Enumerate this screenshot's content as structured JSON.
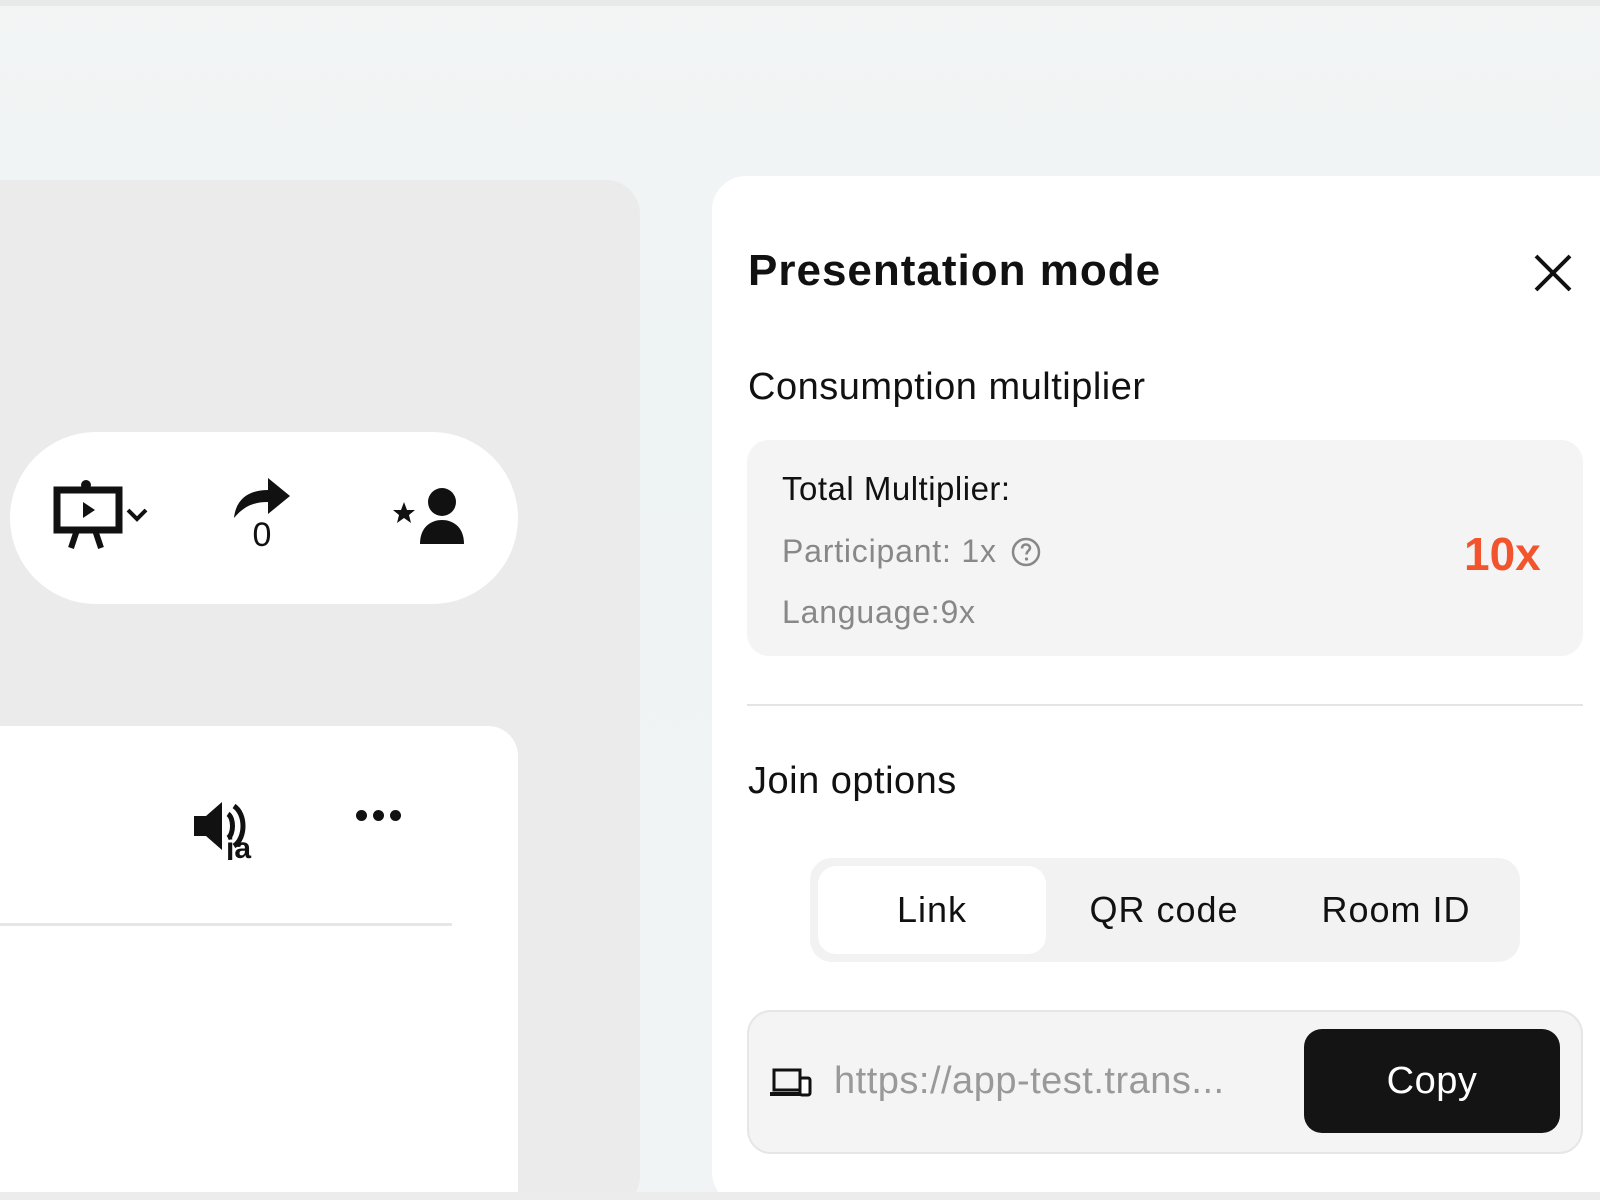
{
  "toolbar": {
    "share_count": "0"
  },
  "audio": {
    "language_badge": "ja"
  },
  "panel": {
    "title": "Presentation mode",
    "consumption_label": "Consumption multiplier",
    "multiplier": {
      "total_label": "Total Multiplier:",
      "participant_label": "Participant: 1x",
      "language_label": "Language:9x",
      "total_value": "10x",
      "value_color": "#f2542d"
    },
    "join_label": "Join options",
    "tabs": [
      {
        "label": "Link",
        "selected": true
      },
      {
        "label": "QR code",
        "selected": false
      },
      {
        "label": "Room ID",
        "selected": false
      }
    ],
    "link": {
      "url": "https://app-test.trans...",
      "copy_label": "Copy"
    }
  }
}
